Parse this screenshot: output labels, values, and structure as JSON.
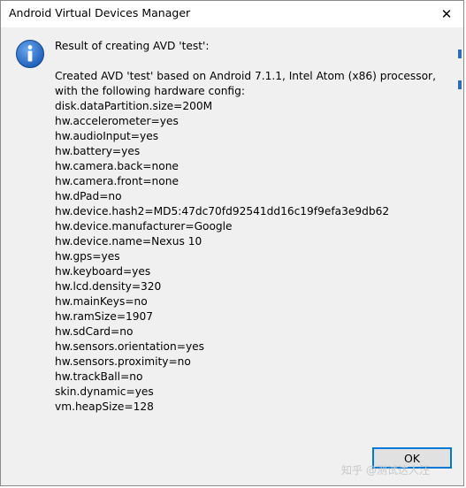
{
  "window": {
    "title": "Android Virtual Devices Manager",
    "close_glyph": "✕"
  },
  "dialog": {
    "icon": "info-icon",
    "heading": "Result of creating AVD 'test':",
    "lines": [
      "Created AVD 'test' based on Android 7.1.1, Intel Atom (x86) processor,",
      "with the following hardware config:",
      "disk.dataPartition.size=200M",
      "hw.accelerometer=yes",
      "hw.audioInput=yes",
      "hw.battery=yes",
      "hw.camera.back=none",
      "hw.camera.front=none",
      "hw.dPad=no",
      "hw.device.hash2=MD5:47dc70fd92541dd16c19f9efa3e9db62",
      "hw.device.manufacturer=Google",
      "hw.device.name=Nexus 10",
      "hw.gps=yes",
      "hw.keyboard=yes",
      "hw.lcd.density=320",
      "hw.mainKeys=no",
      "hw.ramSize=1907",
      "hw.sdCard=no",
      "hw.sensors.orientation=yes",
      "hw.sensors.proximity=no",
      "hw.trackBall=no",
      "skin.dynamic=yes",
      "vm.heapSize=128"
    ],
    "ok_label": "OK"
  },
  "watermark": "知乎 @测试达人汪",
  "colors": {
    "accent": "#0078d7",
    "icon_blue": "#1f5fb8",
    "dialog_bg": "#f0f0f0"
  }
}
